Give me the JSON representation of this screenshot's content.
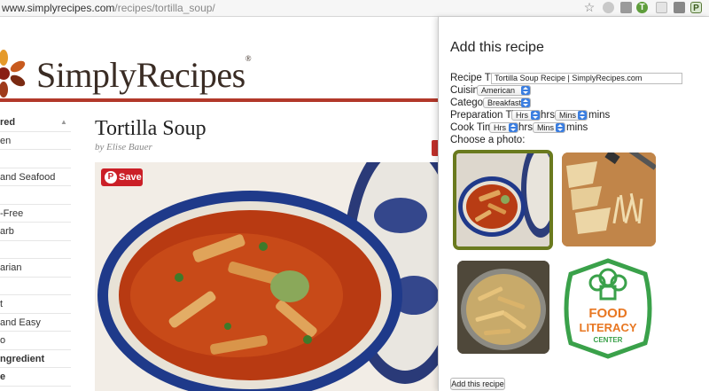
{
  "browser": {
    "url_host": "www.simplyrecipes.com",
    "url_path": "/recipes/tortilla_soup/",
    "extension_badge_letter": "T",
    "extension_active_letter": "P"
  },
  "site": {
    "logo_text": "SimplyRecipes",
    "brand_color": "#b2382a"
  },
  "sidebar": {
    "items": [
      {
        "label": "red",
        "bold": true
      },
      {
        "label": "en",
        "bold": false
      },
      {
        "label": "",
        "bold": false
      },
      {
        "label": "and Seafood",
        "bold": false
      },
      {
        "label": "",
        "bold": false
      },
      {
        "label": "-Free",
        "bold": false
      },
      {
        "label": "arb",
        "bold": false
      },
      {
        "label": "",
        "bold": false
      },
      {
        "label": "arian",
        "bold": false
      },
      {
        "label": "",
        "bold": false
      },
      {
        "label": "t",
        "bold": false
      },
      {
        "label": "and Easy",
        "bold": false
      },
      {
        "label": "o",
        "bold": false
      },
      {
        "label": "ngredient",
        "bold": true
      },
      {
        "label": "e",
        "bold": true
      }
    ]
  },
  "recipe": {
    "title": "Tortilla Soup",
    "byline_prefix": "by",
    "author": "Elise Bauer",
    "save_label": "Save"
  },
  "popup": {
    "title": "Add this recipe",
    "recipe_title_label": "Recipe Title",
    "recipe_title_value": "Tortilla Soup Recipe | SimplyRecipes.com",
    "cuisine_label": "Cuisine",
    "cuisine_value": "American",
    "category_label": "Category",
    "category_value": "Breakfast",
    "prep_label": "Preparation Time",
    "prep_hrs_value": "Hrs",
    "prep_hrs_unit": "hrs",
    "prep_mins_value": "Mins",
    "prep_mins_unit": "mins",
    "cook_label": "Cook Time",
    "cook_hrs_value": "Hrs",
    "cook_hrs_unit": "hrs",
    "cook_mins_value": "Mins",
    "cook_mins_unit": "mins",
    "photo_label": "Choose a photo:",
    "logo_line1": "FOOD",
    "logo_line2": "LITERACY",
    "logo_line3": "CENTER",
    "logo_green": "#3aa14a",
    "logo_orange": "#e87722",
    "submit_label": "Add this recipe"
  }
}
